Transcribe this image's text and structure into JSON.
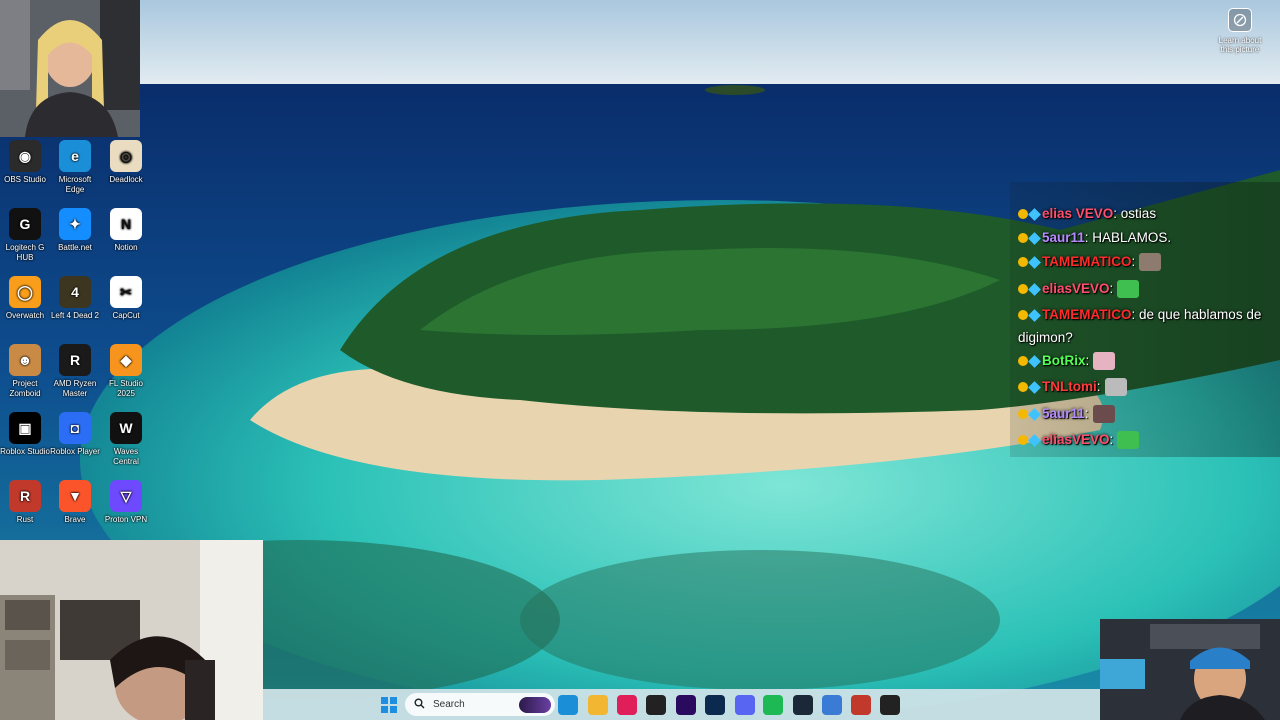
{
  "desktop": {
    "learn_label": "Learn about this picture",
    "icons": [
      {
        "label": "OBS Studio",
        "icon": "obs-icon",
        "color": "#2b2b2b"
      },
      {
        "label": "Microsoft Edge",
        "icon": "edge-icon",
        "color": "#1a8fd8"
      },
      {
        "label": "Deadlock",
        "icon": "deadlock-icon",
        "color": "#e9dcc0"
      },
      {
        "label": "Logitech G HUB",
        "icon": "logitech-icon",
        "color": "#111111"
      },
      {
        "label": "Battle.net",
        "icon": "battlenet-icon",
        "color": "#148eff"
      },
      {
        "label": "Notion",
        "icon": "notion-icon",
        "color": "#ffffff"
      },
      {
        "label": "Overwatch",
        "icon": "overwatch-icon",
        "color": "#f99e1a"
      },
      {
        "label": "Left 4 Dead 2",
        "icon": "left4dead-icon",
        "color": "#3c3620"
      },
      {
        "label": "CapCut",
        "icon": "capcut-icon",
        "color": "#ffffff"
      },
      {
        "label": "Project Zomboid",
        "icon": "zomboid-icon",
        "color": "#c98a45"
      },
      {
        "label": "AMD Ryzen Master",
        "icon": "ryzen-icon",
        "color": "#1a1a1a"
      },
      {
        "label": "FL Studio 2025",
        "icon": "flstudio-icon",
        "color": "#f7941d"
      },
      {
        "label": "Roblox Studio",
        "icon": "roblox-studio-icon",
        "color": "#000000"
      },
      {
        "label": "Roblox Player",
        "icon": "roblox-player-icon",
        "color": "#2b6df5"
      },
      {
        "label": "Waves Central",
        "icon": "waves-icon",
        "color": "#111111"
      },
      {
        "label": "Rust",
        "icon": "rust-icon",
        "color": "#c0392b"
      },
      {
        "label": "Brave",
        "icon": "brave-icon",
        "color": "#fb542b"
      },
      {
        "label": "Proton VPN",
        "icon": "protonvpn-icon",
        "color": "#6d4aff"
      }
    ]
  },
  "chat": {
    "messages": [
      {
        "user": "elias VEVO",
        "text": ": ostias",
        "color": "#ff4f6d"
      },
      {
        "user": "5aur11",
        "text": ": HABLAMOS.",
        "color": "#b58cff"
      },
      {
        "user": "TAMEMATICO",
        "text": ":",
        "color": "#ff2a2a"
      },
      {
        "user": "eliasVEVO",
        "text": ":",
        "color": "#ff4f6d"
      },
      {
        "user": "TAMEMATICO",
        "text": ": de que hablamos de digimon?",
        "color": "#ff2a2a"
      },
      {
        "user": "BotRix",
        "text": ":",
        "color": "#55ff55"
      },
      {
        "user": "TNLtomi",
        "text": ":",
        "color": "#ff3b3b"
      },
      {
        "user": "5aur11",
        "text": ":",
        "color": "#b58cff"
      },
      {
        "user": "eliasVEVO",
        "text": ":",
        "color": "#ff4f6d"
      }
    ]
  },
  "taskbar": {
    "search_placeholder": "Search",
    "apps": [
      {
        "name": "start-icon",
        "color": "#1e8fe0"
      },
      {
        "name": "edge-icon",
        "color": "#1a8fd8"
      },
      {
        "name": "file-explorer-icon",
        "color": "#f2b632"
      },
      {
        "name": "slack-icon",
        "color": "#e01e5a"
      },
      {
        "name": "notion-icon",
        "color": "#222222"
      },
      {
        "name": "premiere-icon",
        "color": "#2a0a5e"
      },
      {
        "name": "photoshop-icon",
        "color": "#0b2a4d"
      },
      {
        "name": "discord-icon",
        "color": "#5865f2"
      },
      {
        "name": "spotify-icon",
        "color": "#1db954"
      },
      {
        "name": "steam-icon",
        "color": "#1b2838"
      },
      {
        "name": "monitor-app-icon",
        "color": "#3a7bd5"
      },
      {
        "name": "video-app-icon",
        "color": "#c0392b"
      },
      {
        "name": "obs-taskbar-icon",
        "color": "#222222"
      }
    ]
  }
}
